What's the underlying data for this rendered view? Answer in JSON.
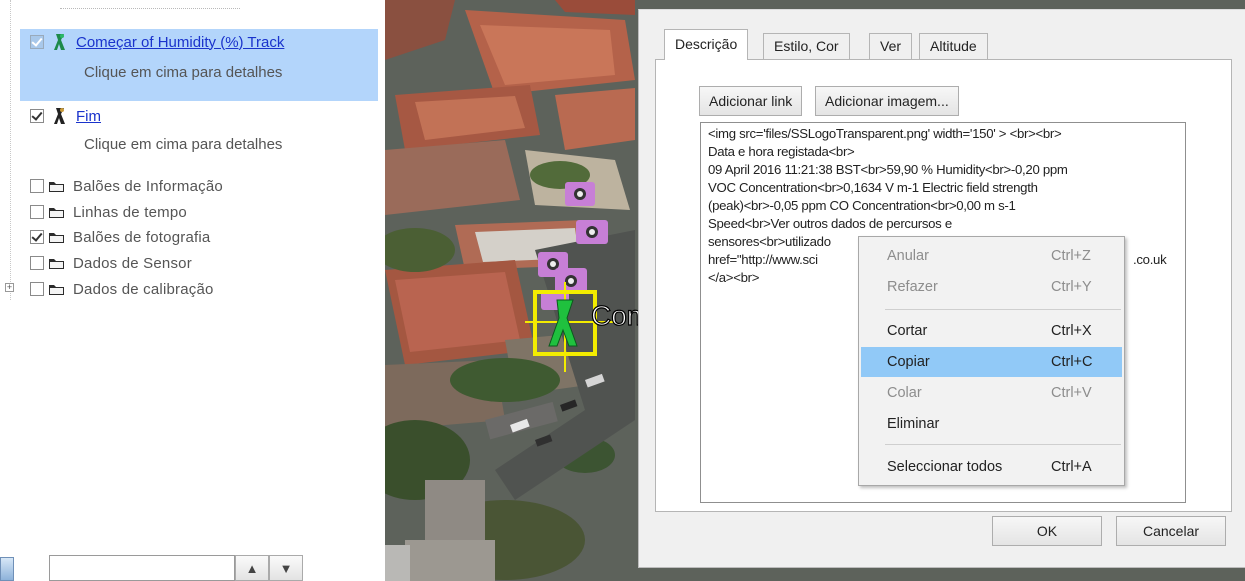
{
  "tree": {
    "items": [
      {
        "label": "Começar of Humidity (%) Track",
        "detail": "Clique em cima para detalhes"
      },
      {
        "label": "Fim",
        "detail": "Clique em cima para detalhes"
      }
    ],
    "folders": [
      {
        "label": "Balões de Informação",
        "checked": false
      },
      {
        "label": "Linhas de tempo",
        "checked": false
      },
      {
        "label": "Balões de fotografia",
        "checked": true
      },
      {
        "label": "Dados de Sensor",
        "checked": false
      },
      {
        "label": "Dados de calibração",
        "checked": false
      }
    ],
    "search_value": ""
  },
  "map": {
    "marker_label": "Com"
  },
  "dialog": {
    "tabs": [
      "Descrição",
      "Estilo, Cor",
      "Ver",
      "Altitude"
    ],
    "add_link": "Adicionar link",
    "add_image": "Adicionar imagem...",
    "html_lines": [
      "<img src='files/SSLogoTransparent.png' width='150' > <br><br>",
      "Data e hora registada<br>",
      "09 April 2016 11:21:38 BST<br>59,90 % Humidity<br>-0,20 ppm",
      "VOC Concentration<br>0,1634 V m-1 Electric field strength",
      "(peak)<br>-0,05 ppm CO Concentration<br>0,00 m s-1",
      "Speed<br>Ver outros dados de percursos e",
      "sensores<br>utilizado",
      "href=\"http://www.sci",
      "</a><br>"
    ],
    "html_tail_fragment": ".co.uk",
    "ok": "OK",
    "cancel": "Cancelar"
  },
  "context_menu": {
    "items": [
      {
        "label": "Anular",
        "shortcut": "Ctrl+Z",
        "enabled": false
      },
      {
        "label": "Refazer",
        "shortcut": "Ctrl+Y",
        "enabled": false
      },
      {
        "label": "Cortar",
        "shortcut": "Ctrl+X",
        "enabled": true
      },
      {
        "label": "Copiar",
        "shortcut": "Ctrl+C",
        "enabled": true,
        "highlighted": true
      },
      {
        "label": "Colar",
        "shortcut": "Ctrl+V",
        "enabled": false
      },
      {
        "label": "Eliminar",
        "shortcut": "",
        "enabled": true
      },
      {
        "label": "Seleccionar todos",
        "shortcut": "Ctrl+A",
        "enabled": true
      }
    ]
  },
  "icons": {
    "tree_item_1": "green-walker-pin-icon",
    "tree_item_2": "dark-walker-pin-icon",
    "folders": "folder-icon",
    "photo_balloons_on_map": "camera-icon",
    "search_prev": "arrow-up-icon",
    "search_next": "arrow-down-icon"
  },
  "colors": {
    "selection": "#b3d5fb",
    "link": "#1a33cc",
    "menu_highlight": "#91c9f7",
    "marker_box": "#f3ec00",
    "camera_balloon": "#c77fd6"
  }
}
